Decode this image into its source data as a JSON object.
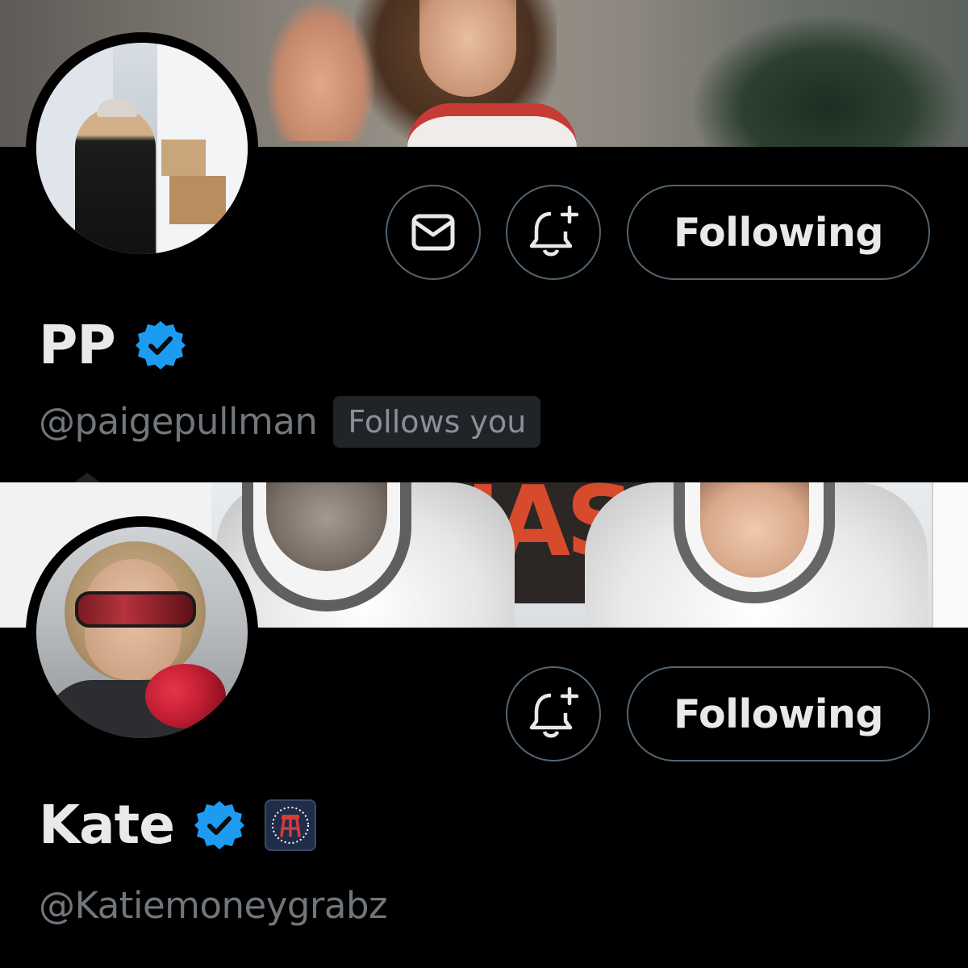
{
  "profiles": [
    {
      "display_name": "PP",
      "handle": "@paigepullman",
      "follows_you_label": "Follows you",
      "follow_button_label": "Following",
      "verified": true,
      "has_message_button": true,
      "has_notify_button": true
    },
    {
      "display_name": "Kate",
      "handle": "@Katiemoneygrabz",
      "follow_button_label": "Following",
      "verified": true,
      "affiliate_badge": "barstool-affiliate-icon",
      "has_message_button": false,
      "has_notify_button": true
    }
  ],
  "banner_2": {
    "logo_text": "NASA"
  },
  "colors": {
    "background": "#000000",
    "text_primary": "#e7e9ea",
    "text_secondary": "#71767b",
    "button_border": "#536471",
    "verified_blue": "#1d9bf0"
  },
  "icons": {
    "message": "envelope-icon",
    "notify": "bell-plus-icon",
    "verified": "verified-badge-icon"
  }
}
